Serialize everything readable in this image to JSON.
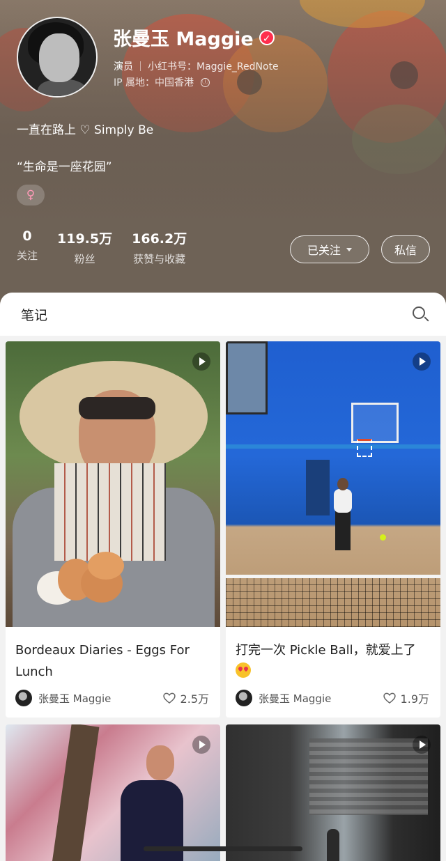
{
  "profile": {
    "name": "张曼玉 Maggie",
    "verified_mark": "✓",
    "role": "演员",
    "redbook_id": "小红书号：Maggie_RedNote",
    "ip_location": "IP 属地：中国香港",
    "info_icon": "ⓘ",
    "bio_line1": "一直在路上 ♡ Simply Be",
    "bio_line2": "“生命是一座花园”",
    "gender_symbol": "♀",
    "gender_color": "#ff9ab8",
    "stats": [
      {
        "value": "0",
        "label": "关注"
      },
      {
        "value": "119.5万",
        "label": "粉丝"
      },
      {
        "value": "166.2万",
        "label": "获赞与收藏"
      }
    ],
    "follow_button": "已关注",
    "message_button": "私信"
  },
  "tabs": {
    "notes_label": "笔记",
    "search_icon": "search-icon"
  },
  "notes": [
    {
      "title": "Bordeaux Diaries - Eggs For Lunch",
      "author": "张曼玉 Maggie",
      "likes": "2.5万",
      "is_video": true
    },
    {
      "title": "打完一次 Pickle Ball，就爱上了",
      "title_emoji": "heart-eyes-emoji",
      "author": "张曼玉 Maggie",
      "likes": "1.9万",
      "is_video": true
    },
    {
      "title": "",
      "author": "",
      "likes": "",
      "is_video": true
    },
    {
      "title": "",
      "author": "",
      "likes": "",
      "is_video": true
    }
  ],
  "colors": {
    "accent_red": "#ff2e4d",
    "header_bg": "#76675a"
  }
}
